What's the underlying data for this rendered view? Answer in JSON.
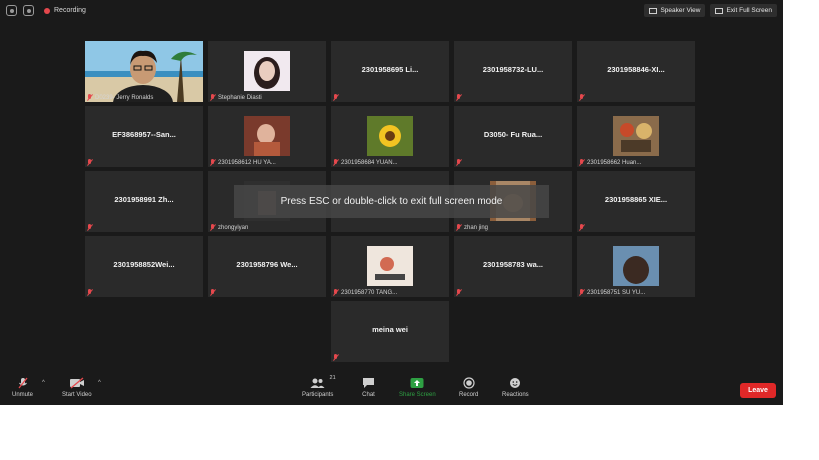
{
  "top": {
    "recording_label": "Recording",
    "speaker_view": "Speaker View",
    "exit_full_screen": "Exit Full Screen"
  },
  "tiles": [
    {
      "name": "D0239- Jerry Ronalds",
      "kind": "video"
    },
    {
      "name": "Stephanie Diasti",
      "kind": "photo"
    },
    {
      "name": "2301958695 Li...",
      "kind": "text"
    },
    {
      "name": "2301958732-LU...",
      "kind": "text"
    },
    {
      "name": "2301958846-XI...",
      "kind": "text"
    },
    {
      "name": "EF3868957--San...",
      "kind": "text"
    },
    {
      "name": "2301958612 HU YA...",
      "kind": "photo"
    },
    {
      "name": "2301958684 YUAN...",
      "kind": "photo"
    },
    {
      "name": "D3050- Fu Rua...",
      "kind": "text"
    },
    {
      "name": "2301958662 Huan...",
      "kind": "photo"
    },
    {
      "name": "2301958991 Zh...",
      "kind": "text"
    },
    {
      "name": "zhongyiyan",
      "kind": "photo"
    },
    {
      "name": "",
      "kind": "empty"
    },
    {
      "name": "zhan jing",
      "kind": "photo"
    },
    {
      "name": "2301958865 XIE...",
      "kind": "text"
    },
    {
      "name": "2301958852Wei...",
      "kind": "text"
    },
    {
      "name": "2301958796 We...",
      "kind": "text"
    },
    {
      "name": "2301958770 TANG...",
      "kind": "photo"
    },
    {
      "name": "2301958783 wa...",
      "kind": "text"
    },
    {
      "name": "2301958751 SU YU...",
      "kind": "photo"
    },
    {
      "name": "",
      "kind": "none"
    },
    {
      "name": "",
      "kind": "none"
    },
    {
      "name": "meina wei",
      "kind": "text"
    }
  ],
  "toast": "Press ESC or double-click to exit full screen mode",
  "toolbar": {
    "unmute": "Unmute",
    "start_video": "Start Video",
    "participants": "Participants",
    "participants_count": "21",
    "chat": "Chat",
    "share_screen": "Share Screen",
    "record": "Record",
    "reactions": "Reactions",
    "leave": "Leave"
  },
  "colors": {
    "leave": "#e02828",
    "share": "#2ea043",
    "active_border": "#c6d94a"
  }
}
